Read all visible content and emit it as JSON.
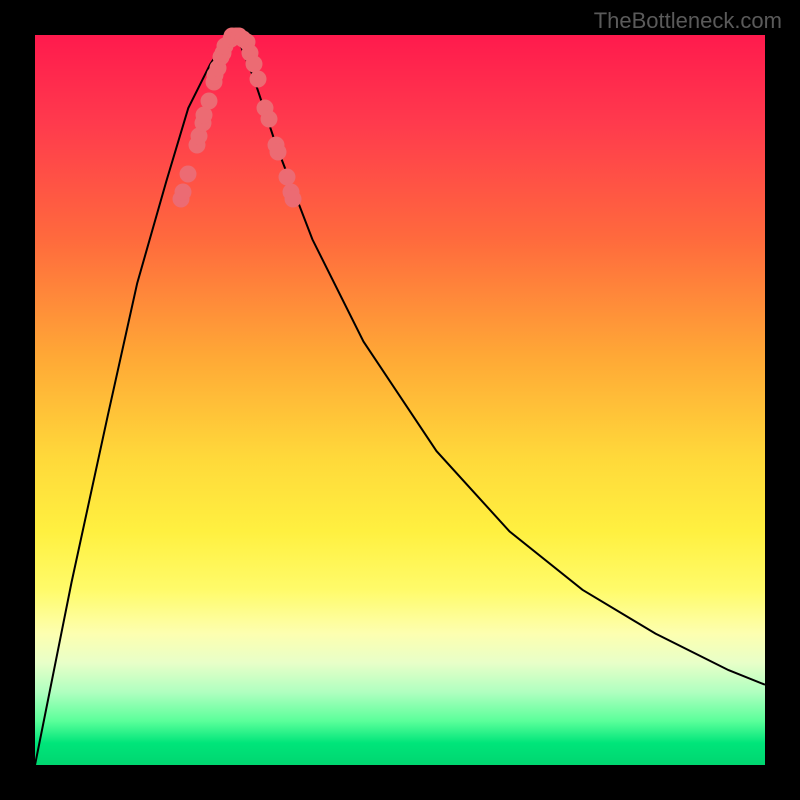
{
  "watermark": "TheBottleneck.com",
  "chart_data": {
    "type": "line",
    "title": "",
    "xlabel": "",
    "ylabel": "",
    "xlim": [
      0,
      100
    ],
    "ylim": [
      0,
      100
    ],
    "series": [
      {
        "name": "bottleneck-curve",
        "x": [
          0,
          5,
          10,
          14,
          18,
          21,
          24,
          26,
          27,
          28,
          30,
          33,
          38,
          45,
          55,
          65,
          75,
          85,
          95,
          100
        ],
        "y": [
          0,
          25,
          48,
          66,
          80,
          90,
          96,
          99,
          100,
          99,
          94,
          85,
          72,
          58,
          43,
          32,
          24,
          18,
          13,
          11
        ]
      }
    ],
    "points": {
      "name": "highlighted-points",
      "color": "#ec6b73",
      "data": [
        {
          "x": 20.0,
          "y": 77.5
        },
        {
          "x": 20.3,
          "y": 78.5
        },
        {
          "x": 21.0,
          "y": 81.0
        },
        {
          "x": 22.2,
          "y": 85.0
        },
        {
          "x": 22.5,
          "y": 86.2
        },
        {
          "x": 23.0,
          "y": 88.0
        },
        {
          "x": 23.2,
          "y": 89.0
        },
        {
          "x": 23.8,
          "y": 91.0
        },
        {
          "x": 24.5,
          "y": 93.5
        },
        {
          "x": 24.7,
          "y": 94.5
        },
        {
          "x": 25.0,
          "y": 95.5
        },
        {
          "x": 25.5,
          "y": 97.0
        },
        {
          "x": 25.7,
          "y": 97.5
        },
        {
          "x": 26.0,
          "y": 98.5
        },
        {
          "x": 26.8,
          "y": 99.5
        },
        {
          "x": 27.0,
          "y": 99.8
        },
        {
          "x": 27.5,
          "y": 99.9
        },
        {
          "x": 28.0,
          "y": 99.8
        },
        {
          "x": 28.5,
          "y": 99.5
        },
        {
          "x": 29.0,
          "y": 99.0
        },
        {
          "x": 29.5,
          "y": 97.5
        },
        {
          "x": 30.0,
          "y": 96.0
        },
        {
          "x": 30.5,
          "y": 94.0
        },
        {
          "x": 31.5,
          "y": 90.0
        },
        {
          "x": 32.0,
          "y": 88.5
        },
        {
          "x": 33.0,
          "y": 85.0
        },
        {
          "x": 33.3,
          "y": 84.0
        },
        {
          "x": 34.5,
          "y": 80.5
        },
        {
          "x": 35.0,
          "y": 78.5
        },
        {
          "x": 35.3,
          "y": 77.5
        }
      ]
    },
    "background_gradient": {
      "description": "Vertical gradient from red (top, high bottleneck) through orange, yellow to green (bottom, low bottleneck)",
      "stops": [
        {
          "pos": 0,
          "color": "#ff1a4d"
        },
        {
          "pos": 50,
          "color": "#ffd93a"
        },
        {
          "pos": 100,
          "color": "#00d670"
        }
      ]
    }
  }
}
